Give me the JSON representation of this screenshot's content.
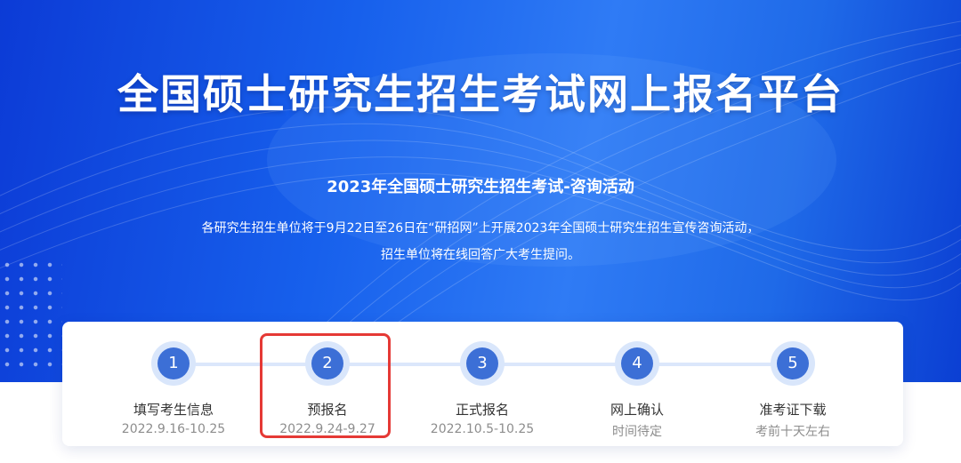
{
  "hero": {
    "title": "全国硕士研究生招生考试网上报名平台",
    "subtitle": "2023年全国硕士研究生招生考试-咨询活动",
    "desc_line1": "各研究生招生单位将于9月22日至26日在“研招网”上开展2023年全国硕士研究生招生宣传咨询活动，",
    "desc_line2": "招生单位将在线回答广大考生提问。"
  },
  "steps": [
    {
      "num": "1",
      "label": "填写考生信息",
      "date": "2022.9.16-10.25"
    },
    {
      "num": "2",
      "label": "预报名",
      "date": "2022.9.24-9.27"
    },
    {
      "num": "3",
      "label": "正式报名",
      "date": "2022.10.5-10.25"
    },
    {
      "num": "4",
      "label": "网上确认",
      "date": "时间待定"
    },
    {
      "num": "5",
      "label": "准考证下载",
      "date": "考前十天左右"
    }
  ],
  "colors": {
    "hero_blue": "#1760ec",
    "step_circle": "#3c6fd6",
    "highlight_red": "#e53935"
  }
}
